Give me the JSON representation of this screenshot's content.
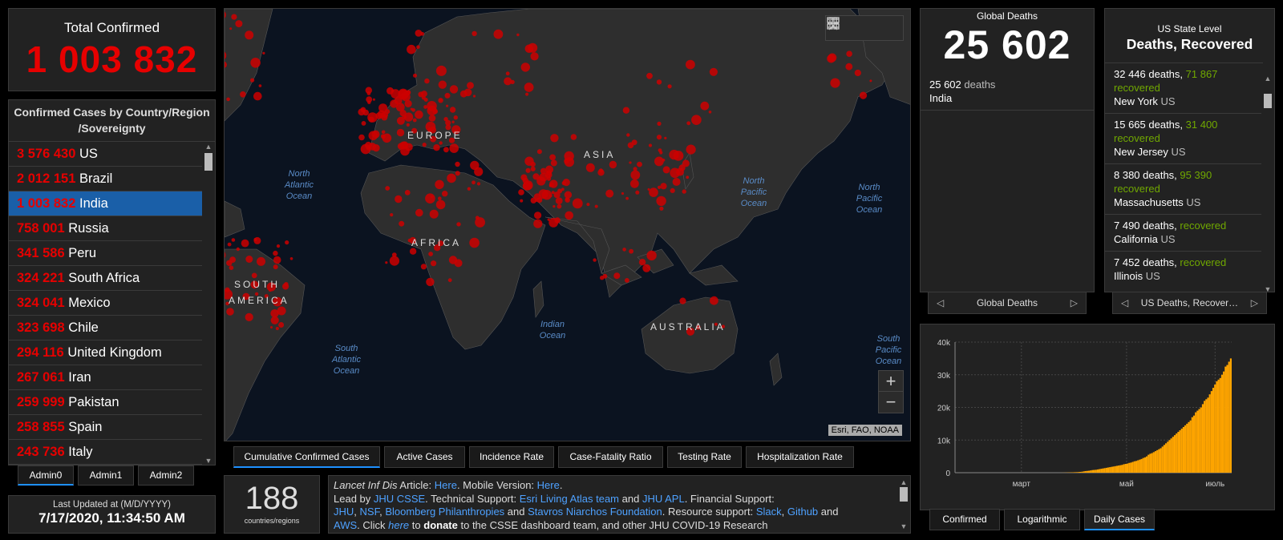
{
  "total_confirmed": {
    "label": "Total Confirmed",
    "value": "1 003 832"
  },
  "country_list": {
    "header_line1": "Confirmed Cases by Country/Region",
    "header_line2": "/Sovereignty",
    "items": [
      {
        "num": "3 576 430",
        "name": "US"
      },
      {
        "num": "2 012 151",
        "name": "Brazil"
      },
      {
        "num": "1 003 832",
        "name": "India",
        "selected": true
      },
      {
        "num": "758 001",
        "name": "Russia"
      },
      {
        "num": "341 586",
        "name": "Peru"
      },
      {
        "num": "324 221",
        "name": "South Africa"
      },
      {
        "num": "324 041",
        "name": "Mexico"
      },
      {
        "num": "323 698",
        "name": "Chile"
      },
      {
        "num": "294 116",
        "name": "United Kingdom"
      },
      {
        "num": "267 061",
        "name": "Iran"
      },
      {
        "num": "259 999",
        "name": "Pakistan"
      },
      {
        "num": "258 855",
        "name": "Spain"
      },
      {
        "num": "243 736",
        "name": "Italy"
      }
    ]
  },
  "admin_tabs": [
    "Admin0",
    "Admin1",
    "Admin2"
  ],
  "last_updated": {
    "label": "Last Updated at (M/D/YYYY)",
    "value": "7/17/2020, 11:34:50 AM"
  },
  "map": {
    "labels": {
      "europe": "EUROPE",
      "asia": "ASIA",
      "africa": "AFRICA",
      "australia": "AUSTRALIA",
      "south_america_1": "SOUTH",
      "south_america_2": "AMERICA",
      "north_atlantic": [
        "North",
        "Atlantic",
        "Ocean"
      ],
      "north_pacific_1": [
        "North",
        "Pacific",
        "Ocean"
      ],
      "north_pacific_2": [
        "North",
        "Pacific",
        "Ocean"
      ],
      "south_atlantic": [
        "South",
        "Atlantic",
        "Ocean"
      ],
      "indian": [
        "Indian",
        "Ocean"
      ],
      "south_pacific": [
        "South",
        "Pacific",
        "Ocean"
      ]
    },
    "attribution": "Esri, FAO, NOAA",
    "zoom_in": "+",
    "zoom_out": "−"
  },
  "map_tabs": [
    "Cumulative Confirmed Cases",
    "Active Cases",
    "Incidence Rate",
    "Case-Fatality Ratio",
    "Testing Rate",
    "Hospitalization Rate"
  ],
  "countries_count": {
    "value": "188",
    "label": "countries/regions"
  },
  "info": {
    "line1": {
      "a": "Lancet Inf Dis",
      "b": " Article: ",
      "c": "Here",
      "d": ". Mobile Version: ",
      "e": "Here",
      "f": "."
    },
    "line2": {
      "a": "Lead by ",
      "b": "JHU CSSE",
      "c": ". Technical Support: ",
      "d": "Esri Living Atlas team",
      "e": " and ",
      "f": "JHU APL",
      "g": ". Financial Support:"
    },
    "line3": {
      "a": "JHU",
      "b": ", ",
      "c": "NSF",
      "d": ", ",
      "e": "Bloomberg Philanthropies",
      "f": " and ",
      "g": "Stavros Niarchos Foundation",
      "h": ". Resource support: ",
      "i": "Slack",
      "j": ", ",
      "k": "Github",
      "l": " and"
    },
    "line4": {
      "a": "AWS",
      "b": ". Click ",
      "c": "here",
      "d": " to ",
      "e": "donate",
      "f": " to the CSSE dashboard team, and other JHU COVID-19 Research"
    }
  },
  "global_deaths": {
    "label": "Global Deaths",
    "value": "25 602",
    "item_num": "25 602",
    "item_word": "deaths",
    "item_place": "India",
    "pager_label": "Global Deaths"
  },
  "us_state": {
    "label": "US State Level",
    "title": "Deaths, Recovered",
    "items": [
      {
        "deaths": "32 446 deaths, ",
        "recovered_num": "71 867",
        "recovered_word": "recovered",
        "state": "New York",
        "country": "US"
      },
      {
        "deaths": "15 665 deaths, ",
        "recovered_num": "31 400",
        "recovered_word": "recovered",
        "state": "New Jersey",
        "country": "US"
      },
      {
        "deaths": "8 380 deaths, ",
        "recovered_num": "95 390",
        "recovered_word": "recovered",
        "state": "Massachusetts",
        "country": "US"
      },
      {
        "deaths": "7 490 deaths, ",
        "recovered_num": "",
        "recovered_word": "recovered",
        "state": "California",
        "country": "US"
      },
      {
        "deaths": "7 452 deaths, ",
        "recovered_num": "",
        "recovered_word": "recovered",
        "state": "Illinois",
        "country": "US"
      }
    ],
    "pager_label": "US Deaths, Recover…"
  },
  "chart_tabs": [
    "Confirmed",
    "Logarithmic",
    "Daily Cases"
  ],
  "colors": {
    "case_red": "#e60000",
    "recovered_green": "#70a800",
    "bar_orange": "#ffa500",
    "link_blue": "#4ea1ff",
    "selected_row": "#1a5fa8"
  },
  "chart_data": {
    "type": "bar",
    "title": "",
    "xlabel": "",
    "ylabel": "",
    "ylim": [
      0,
      40000
    ],
    "yticks": [
      "0",
      "10k",
      "20k",
      "30k",
      "40k"
    ],
    "xticks": [
      "март",
      "май",
      "июль"
    ],
    "grid": true,
    "series": [
      {
        "values": [
          0,
          0,
          0,
          0,
          0,
          0,
          0,
          0,
          0,
          0,
          0,
          0,
          0,
          0,
          0,
          0,
          0,
          0,
          0,
          0,
          0,
          0,
          0,
          0,
          0,
          0,
          0,
          0,
          0,
          0,
          0,
          0,
          0,
          0,
          0,
          0,
          0,
          0,
          0,
          0,
          0,
          0,
          0,
          0,
          0,
          0,
          0,
          0,
          0,
          0,
          0,
          0,
          0,
          0,
          0,
          0,
          0,
          0,
          0,
          0,
          10,
          20,
          30,
          50,
          70,
          80,
          100,
          120,
          150,
          170,
          200,
          250,
          300,
          400,
          500,
          550,
          600,
          700,
          800,
          850,
          900,
          1000,
          1100,
          1200,
          1300,
          1400,
          1500,
          1600,
          1700,
          1800,
          1900,
          2000,
          2100,
          2200,
          2300,
          2400,
          2600,
          2700,
          2800,
          3000,
          3100,
          3300,
          3500,
          3600,
          3800,
          4000,
          4200,
          4500,
          4700,
          5000,
          5500,
          5800,
          6000,
          6300,
          6600,
          6900,
          7200,
          7500,
          8000,
          8500,
          9000,
          9500,
          10000,
          10500,
          11000,
          11500,
          12000,
          12500,
          13000,
          13500,
          14000,
          14500,
          15000,
          15500,
          16000,
          17000,
          17500,
          18500,
          19000,
          19500,
          20000,
          21000,
          22000,
          22500,
          23000,
          24000,
          25000,
          26000,
          27000,
          28000,
          28500,
          29000,
          30000,
          31000,
          32500,
          33000,
          34000,
          35000
        ]
      }
    ]
  }
}
